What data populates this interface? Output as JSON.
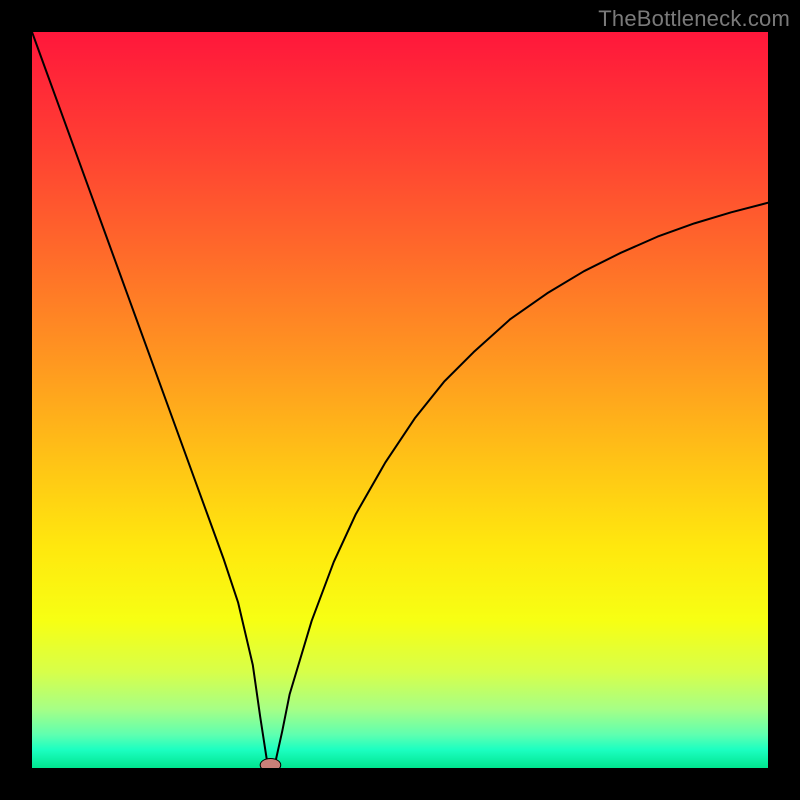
{
  "watermark": "TheBottleneck.com",
  "chart_data": {
    "type": "line",
    "title": "",
    "xlabel": "",
    "ylabel": "",
    "xlim": [
      0,
      100
    ],
    "ylim": [
      0,
      100
    ],
    "legend": false,
    "grid": false,
    "background": {
      "type": "vertical-gradient",
      "stops": [
        {
          "offset": 0.0,
          "color": "#ff173b"
        },
        {
          "offset": 0.15,
          "color": "#ff3e33"
        },
        {
          "offset": 0.3,
          "color": "#ff6a2a"
        },
        {
          "offset": 0.45,
          "color": "#ff9820"
        },
        {
          "offset": 0.58,
          "color": "#ffc216"
        },
        {
          "offset": 0.7,
          "color": "#ffe80e"
        },
        {
          "offset": 0.8,
          "color": "#f7ff13"
        },
        {
          "offset": 0.87,
          "color": "#d7ff4a"
        },
        {
          "offset": 0.92,
          "color": "#a6ff86"
        },
        {
          "offset": 0.955,
          "color": "#5effb0"
        },
        {
          "offset": 0.975,
          "color": "#1cffc1"
        },
        {
          "offset": 1.0,
          "color": "#00e58f"
        }
      ]
    },
    "series": [
      {
        "name": "bottleneck-curve",
        "color": "#000000",
        "stroke_width": 2,
        "x": [
          0,
          2,
          4,
          6,
          8,
          10,
          12,
          14,
          16,
          18,
          20,
          22,
          24,
          26,
          28,
          30,
          31,
          32,
          33,
          34,
          35,
          38,
          41,
          44,
          48,
          52,
          56,
          60,
          65,
          70,
          75,
          80,
          85,
          90,
          95,
          100
        ],
        "y": [
          100,
          94.5,
          89,
          83.5,
          78,
          72.5,
          67,
          61.5,
          56,
          50.5,
          45,
          39.5,
          34,
          28.5,
          22.5,
          14,
          7,
          0.5,
          0.5,
          5,
          10,
          20,
          28,
          34.5,
          41.5,
          47.5,
          52.5,
          56.5,
          61,
          64.5,
          67.5,
          70,
          72.2,
          74,
          75.5,
          76.8
        ]
      }
    ],
    "markers": [
      {
        "name": "min-point",
        "x": 32.4,
        "y": 0.4,
        "rx": 1.4,
        "ry": 0.9,
        "fill": "#c98079",
        "stroke": "#000000"
      }
    ]
  }
}
